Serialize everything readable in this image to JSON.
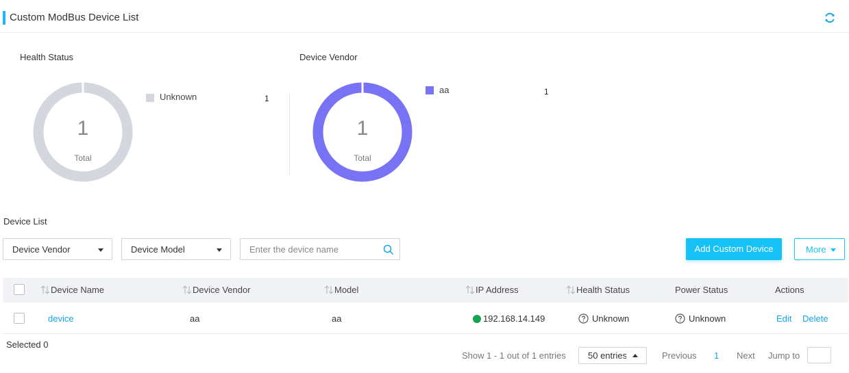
{
  "header": {
    "title": "Custom ModBus Device List",
    "accent_color": "#1fb6ff",
    "refresh_icon": "refresh-icon"
  },
  "health_chart": {
    "title": "Health Status",
    "total_value": "1",
    "total_label": "Total",
    "legend": [
      {
        "label": "Unknown",
        "value": "1",
        "color": "#d4d7de"
      }
    ]
  },
  "vendor_chart": {
    "title": "Device Vendor",
    "total_value": "1",
    "total_label": "Total",
    "legend": [
      {
        "label": "aa",
        "value": "1",
        "color": "#7873f5"
      }
    ]
  },
  "device_list": {
    "section_label": "Device List",
    "filters": {
      "vendor_placeholder": "Device Vendor",
      "model_placeholder": "Device Model",
      "search_placeholder": "Enter the device name"
    },
    "add_button_label": "Add Custom Device",
    "more_button_label": "More",
    "columns": [
      "Device Name",
      "Device Vendor",
      "Model",
      "IP Address",
      "Health Status",
      "Power Status",
      "Actions"
    ],
    "rows": [
      {
        "name": "device",
        "vendor": "aa",
        "model": "aa",
        "ip": "192.168.14.149",
        "ip_status_color": "#14a44d",
        "health": "Unknown",
        "power": "Unknown",
        "actions": [
          "Edit",
          "Delete"
        ]
      }
    ]
  },
  "footer": {
    "selected": "Selected 0",
    "summary": "Show 1 - 1 out of 1 entries",
    "page_size": "50 entries",
    "previous": "Previous",
    "current_page": "1",
    "next": "Next",
    "jump_label": "Jump to"
  }
}
